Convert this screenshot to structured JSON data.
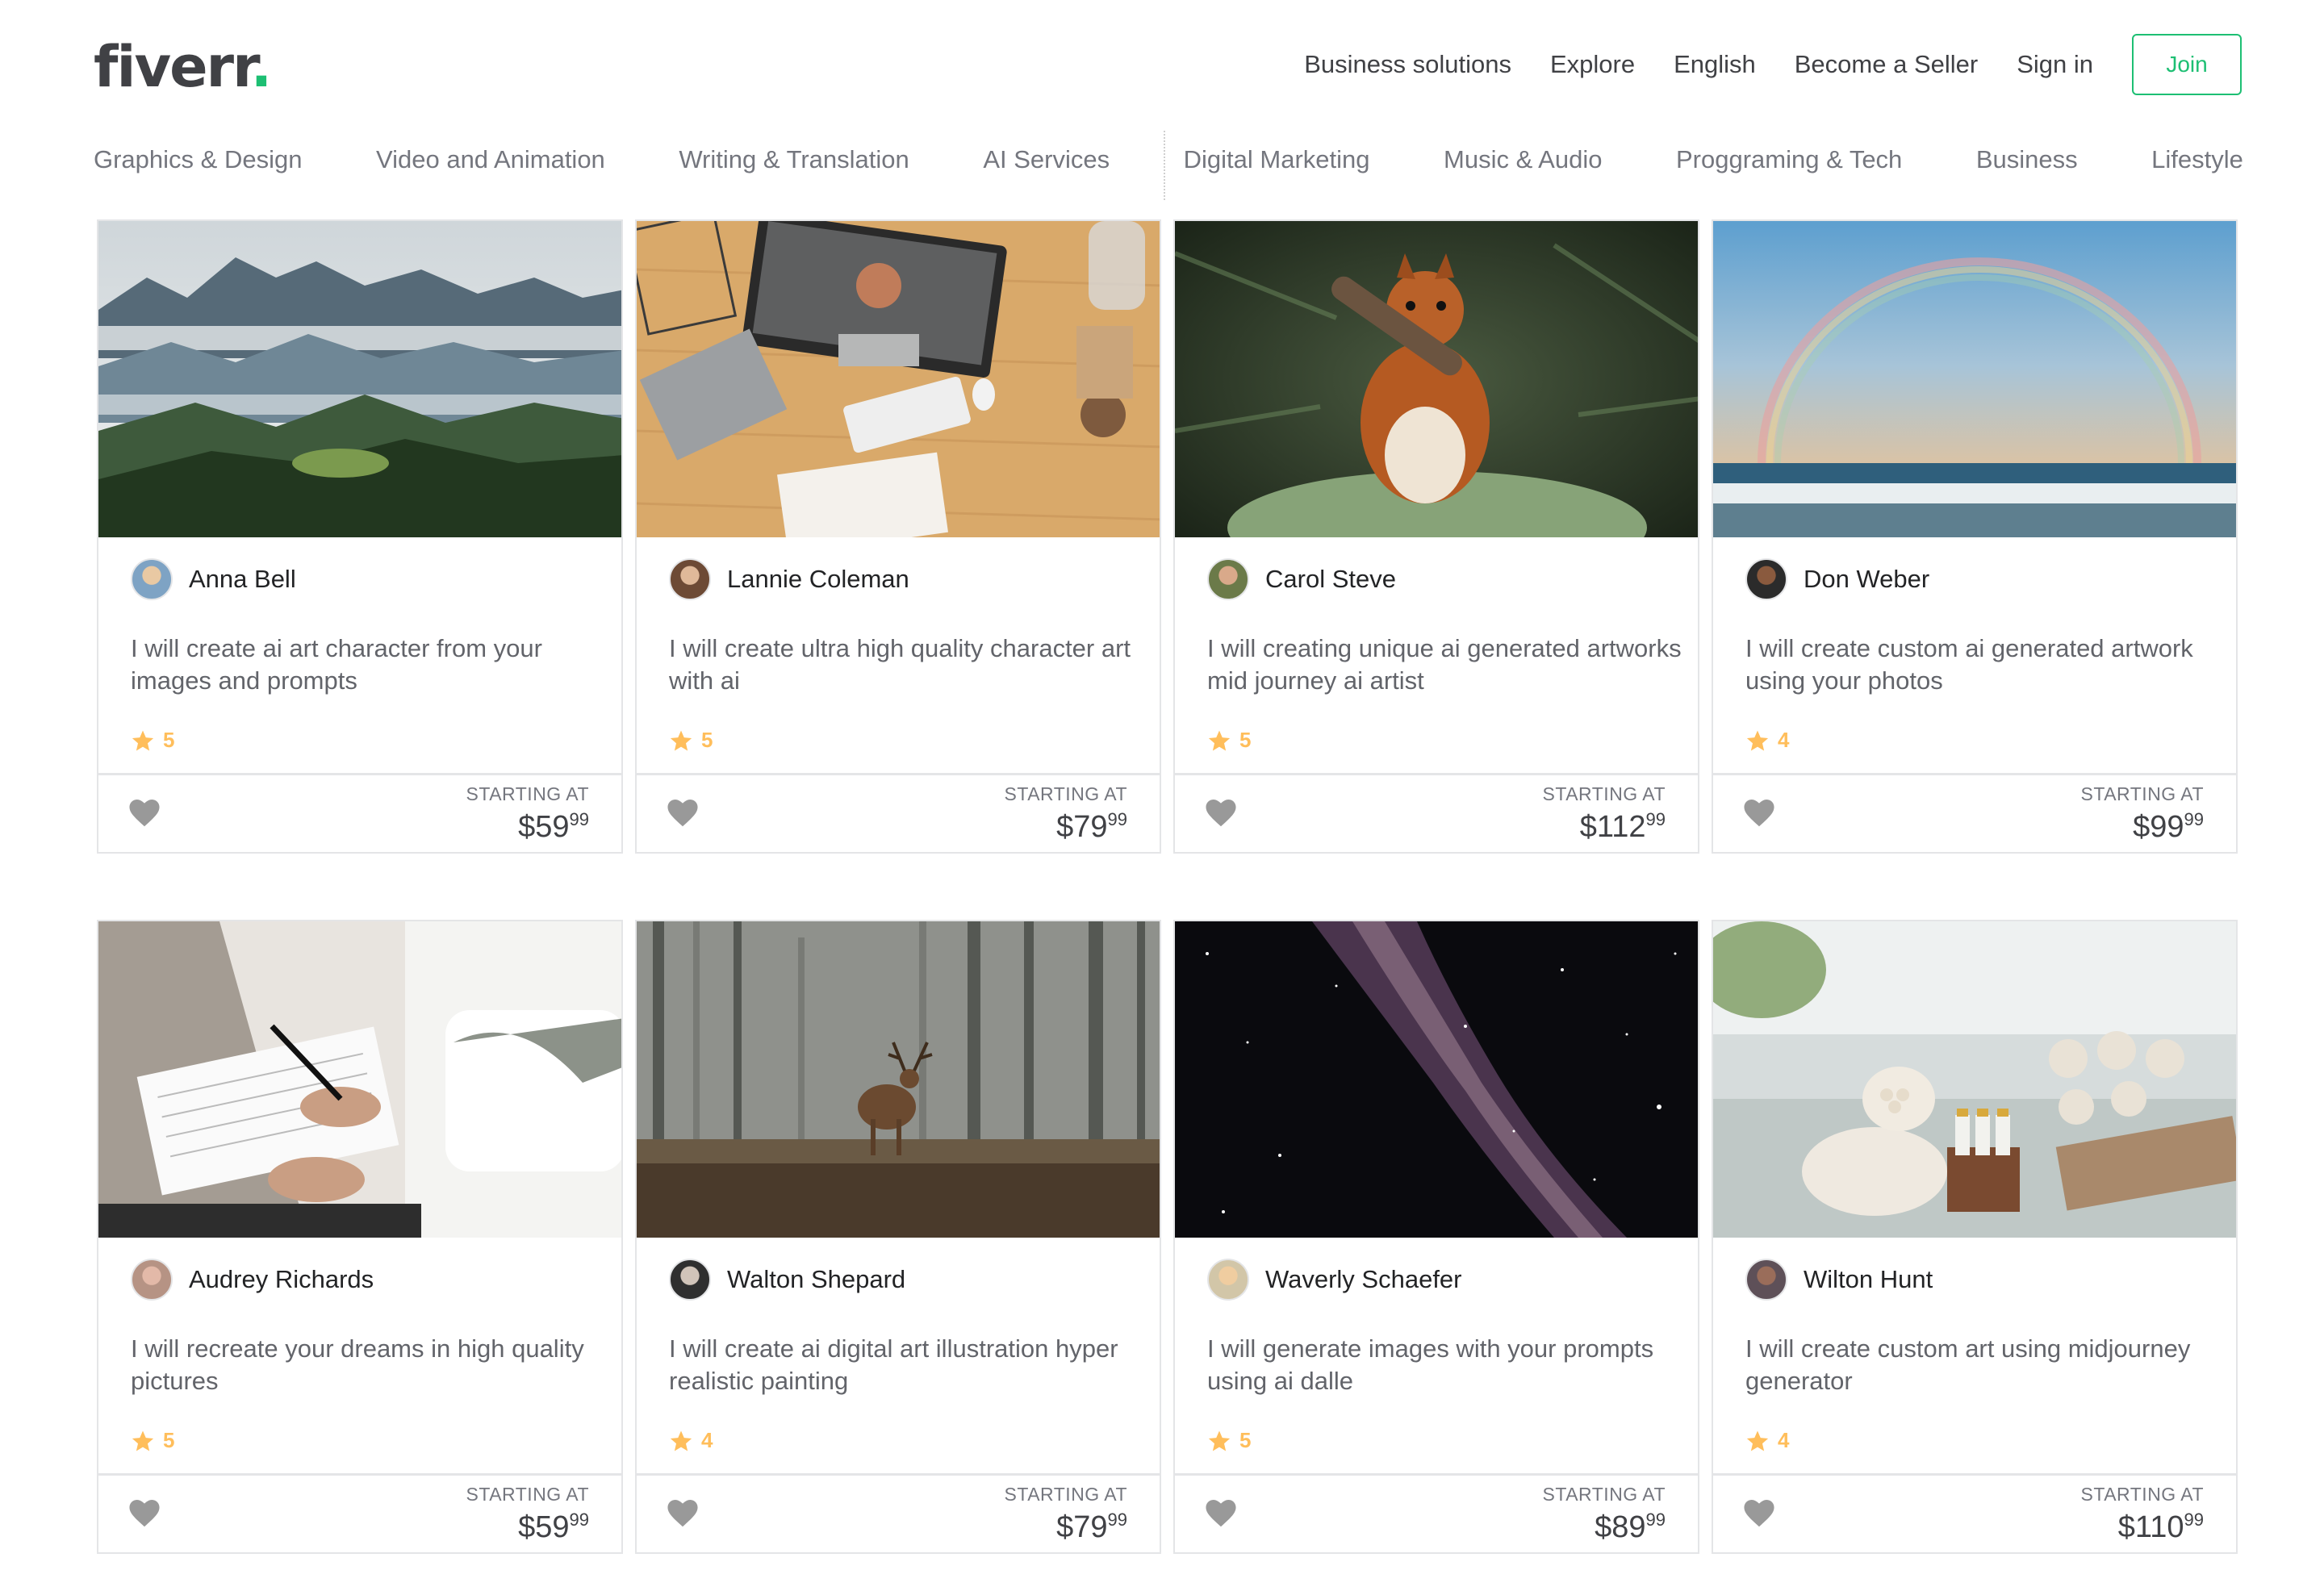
{
  "header": {
    "logo_text": "fiverr",
    "logo_dot": ".",
    "nav": [
      "Business solutions",
      "Explore",
      "English",
      "Become a Seller",
      "Sign in"
    ],
    "join_label": "Join"
  },
  "categories": [
    "Graphics & Design",
    "Video and Animation",
    "Writing & Translation",
    "AI Services",
    "Digital Marketing",
    "Music & Audio",
    "Proggraming & Tech",
    "Business",
    "Lifestyle"
  ],
  "cards": [
    {
      "seller": "Anna Bell",
      "desc": "I will create ai art character from your images and prompts",
      "rating": "5",
      "starting_label": "STARTING AT",
      "price": "$59",
      "cents": "99"
    },
    {
      "seller": "Lannie Coleman",
      "desc": "I will create ultra high quality character art with ai",
      "rating": "5",
      "starting_label": "STARTING AT",
      "price": "$79",
      "cents": "99"
    },
    {
      "seller": "Carol Steve",
      "desc": "I will creating unique ai generated artworks mid journey ai artist",
      "rating": "5",
      "starting_label": "STARTING AT",
      "price": "$112",
      "cents": "99"
    },
    {
      "seller": "Don Weber",
      "desc": "I will create custom ai generated artwork using your photos",
      "rating": "4",
      "starting_label": "STARTING AT",
      "price": "$99",
      "cents": "99"
    },
    {
      "seller": "Audrey Richards",
      "desc": "I will recreate your dreams in high quality pictures",
      "rating": "5",
      "starting_label": "STARTING AT",
      "price": "$59",
      "cents": "99"
    },
    {
      "seller": "Walton Shepard",
      "desc": "I will create ai digital art illustration hyper realistic painting",
      "rating": "4",
      "starting_label": "STARTING AT",
      "price": "$79",
      "cents": "99"
    },
    {
      "seller": "Waverly Schaefer",
      "desc": "I will generate images with your prompts using ai dalle",
      "rating": "5",
      "starting_label": "STARTING AT",
      "price": "$89",
      "cents": "99"
    },
    {
      "seller": "Wilton Hunt",
      "desc": "I will create custom art using midjourney generator",
      "rating": "4",
      "starting_label": "STARTING AT",
      "price": "$110",
      "cents": "99"
    }
  ],
  "colors": {
    "brand": "#1dbf73",
    "star": "#ffbe5b",
    "heart": "#999999"
  }
}
